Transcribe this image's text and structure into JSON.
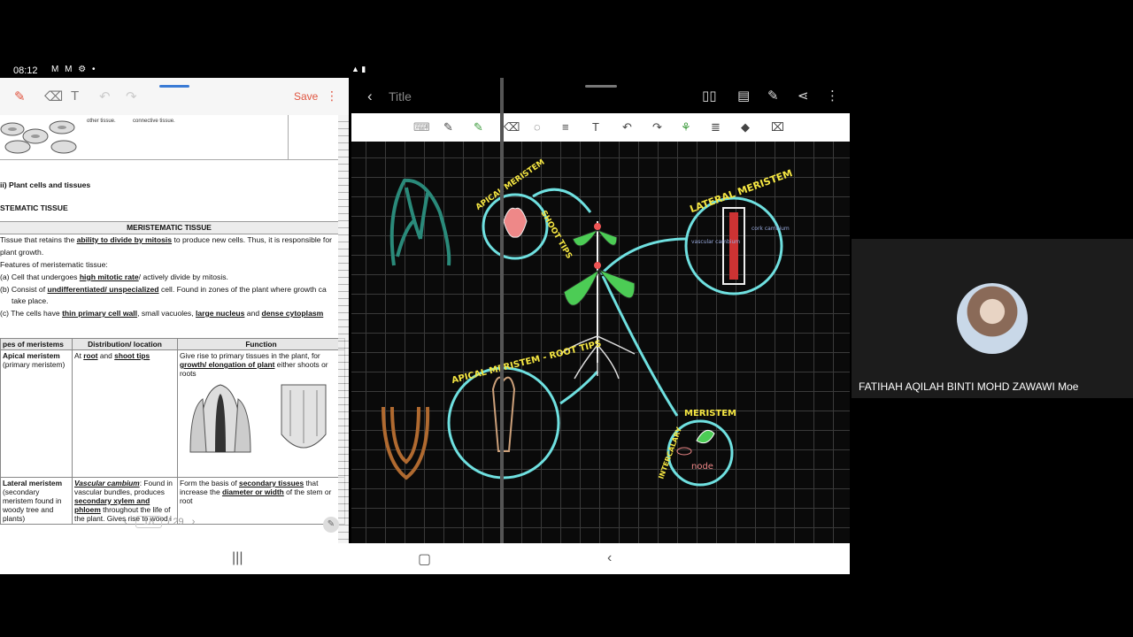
{
  "status": {
    "time": "08:12",
    "icons": "M M ⚙ •",
    "right": "▲ ▮"
  },
  "left": {
    "save_label": "Save",
    "doc": {
      "tiny1": "other tissue.",
      "tiny2": "connective tissue.",
      "section": "ii) Plant cells and tissues",
      "subsection": "STEMATIC TISSUE",
      "table_title": "MERISTEMATIC TISSUE",
      "l1a": "Tissue that retains the ",
      "l1b": "ability to divide by mitosis",
      "l1c": " to produce new cells. Thus, it is responsible for",
      "l2": "plant growth.",
      "l3": "Features of meristematic tissue:",
      "l4a": "(a)  Cell that undergoes ",
      "l4b": "high mitotic rate",
      "l4c": "/ actively divide by mitosis.",
      "l5a": "(b)  Consist of ",
      "l5b": "undifferentiated/ unspecialized",
      "l5c": " cell. Found in zones of the plant where growth ca",
      "l6": "take place.",
      "l7a": "(c)  The cells have ",
      "l7b": "thin primary cell wall",
      "l7c": ", small vacuoles, ",
      "l7d": "large nucleus",
      "l7e": " and ",
      "l7f": "dense cytoplasm",
      "th1": "pes of meristems",
      "th2": "Distribution/ location",
      "th3": "Function",
      "r1c1": "Apical meristem",
      "r1c1b": "(primary meristem)",
      "r1c2a": "At ",
      "r1c2b": "root",
      "r1c2c": " and ",
      "r1c2d": "shoot tips",
      "r1c3a": "Give rise to primary tissues in the plant, for ",
      "r1c3b": "growth/ elongation of plant",
      "r1c3c": " either shoots or roots",
      "r2c1": "Lateral meristem",
      "r2c1b": "(secondary meristem found in woody tree and plants)",
      "r2c2a": "Vascular cambium",
      "r2c2b": ": Found in vascular bundles, produces ",
      "r2c2c": "secondary xylem and phloem",
      "r2c2d": " throughout the life of the plant. Gives rise to wood i",
      "r2c3a": "Form the basis of ",
      "r2c3b": "secondary tissues",
      "r2c3c": " that increase the ",
      "r2c3d": "diameter or width",
      "r2c3e": " of the stem or root"
    },
    "pager": {
      "current": "18",
      "total": "/ 29"
    }
  },
  "right": {
    "title": "Title",
    "labels": {
      "apical": "APICAL MERISTEM",
      "shoot": "SHOOT TIPS",
      "lateral": "LATERAL MERISTEM",
      "root": "APICAL MERISTEM - ROOT TIPS",
      "meristem": "MERISTEM",
      "intercalary": "INTERCALARY",
      "node": "node",
      "vascular": "vascular cambium",
      "cork": "cork cambium"
    }
  },
  "participant": {
    "name": "FATIHAH AQILAH BINTI MOHD ZAWAWI Moe"
  },
  "colors": {
    "neon_blue": "#6fe0e0",
    "neon_yellow": "#f5e642",
    "neon_green": "#4ccc55",
    "teal": "#2a8a7a",
    "brown": "#b06a30",
    "accent": "#e05540"
  }
}
